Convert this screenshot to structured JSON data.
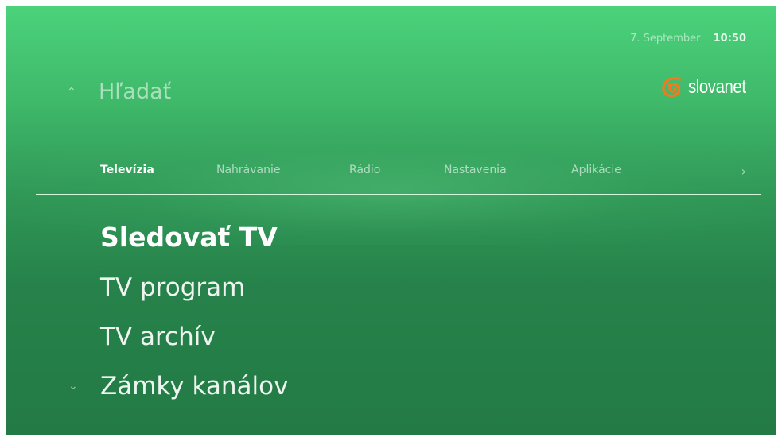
{
  "header": {
    "date": "7. September",
    "time": "10:50",
    "search_label": "Hľadať",
    "logo_text": "slovanet",
    "logo_icon": "swirl-icon",
    "logo_color": "#f47920"
  },
  "tabs": [
    {
      "label": "Televízia",
      "active": true
    },
    {
      "label": "Nahrávanie",
      "active": false
    },
    {
      "label": "Rádio",
      "active": false
    },
    {
      "label": "Nastavenia",
      "active": false
    },
    {
      "label": "Aplikácie",
      "active": false
    }
  ],
  "menu": {
    "items": [
      {
        "label": "Sledovať TV",
        "selected": true
      },
      {
        "label": "TV program",
        "selected": false
      },
      {
        "label": "TV archív",
        "selected": false
      },
      {
        "label": "Zámky kanálov",
        "selected": false
      }
    ]
  },
  "icons": {
    "scroll_up": "chevron-up-icon",
    "scroll_down": "chevron-down-icon",
    "tabs_next": "chevron-right-icon"
  },
  "colors": {
    "background_top": "#4bd27b",
    "background_bottom": "#237a45",
    "text": "#ffffff"
  }
}
